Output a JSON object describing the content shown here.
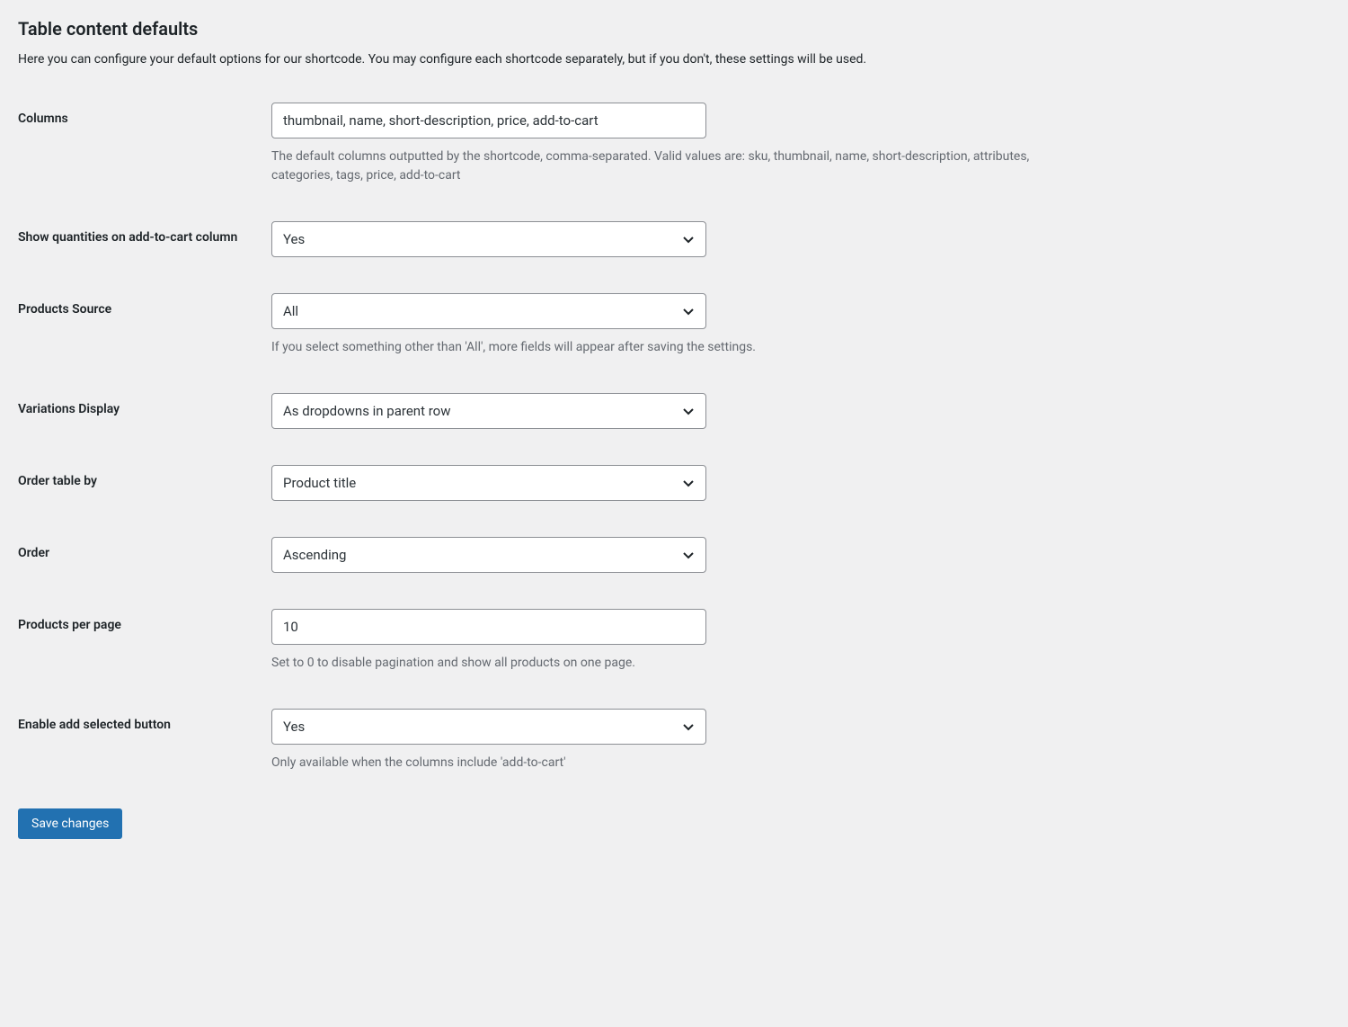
{
  "header": {
    "title": "Table content defaults",
    "description": "Here you can configure your default options for our shortcode. You may configure each shortcode separately, but if you don't, these settings will be used."
  },
  "fields": {
    "columns": {
      "label": "Columns",
      "value": "thumbnail, name, short-description, price, add-to-cart",
      "description": "The default columns outputted by the shortcode, comma-separated. Valid values are: sku, thumbnail, name, short-description, attributes, categories, tags, price, add-to-cart"
    },
    "show_quantities": {
      "label": "Show quantities on add-to-cart column",
      "value": "Yes"
    },
    "products_source": {
      "label": "Products Source",
      "value": "All",
      "description": "If you select something other than 'All', more fields will appear after saving the settings."
    },
    "variations_display": {
      "label": "Variations Display",
      "value": "As dropdowns in parent row"
    },
    "order_by": {
      "label": "Order table by",
      "value": "Product title"
    },
    "order": {
      "label": "Order",
      "value": "Ascending"
    },
    "products_per_page": {
      "label": "Products per page",
      "value": "10",
      "description": "Set to 0 to disable pagination and show all products on one page."
    },
    "enable_add_selected": {
      "label": "Enable add selected button",
      "value": "Yes",
      "description": "Only available when the columns include 'add-to-cart'"
    }
  },
  "actions": {
    "save_label": "Save changes"
  }
}
